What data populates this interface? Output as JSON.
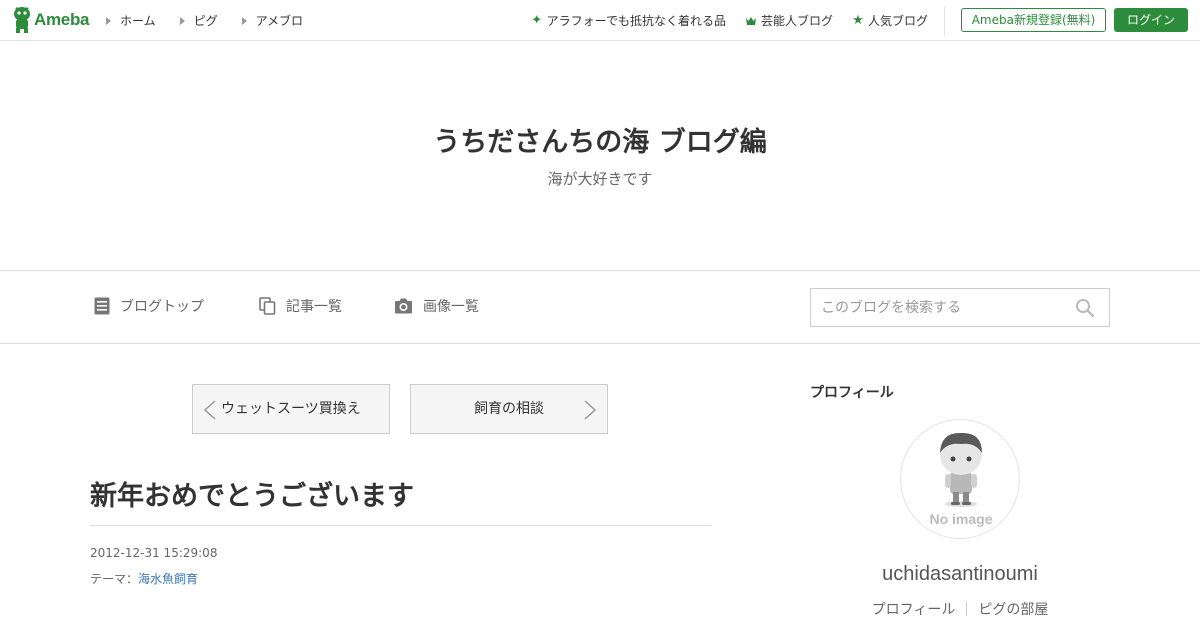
{
  "header": {
    "logo_text": "Ameba",
    "nav": [
      {
        "label": "ホーム"
      },
      {
        "label": "ピグ"
      },
      {
        "label": "アメブロ"
      }
    ],
    "links": [
      {
        "label": "アラフォーでも抵抗なく着れる品",
        "icon": "sparkle-icon"
      },
      {
        "label": "芸能人ブログ",
        "icon": "crown-icon"
      },
      {
        "label": "人気ブログ",
        "icon": "star-icon"
      }
    ],
    "register_label": "Ameba新規登録(無料)",
    "login_label": "ログイン",
    "accent_color": "#2d8c3c"
  },
  "blog": {
    "title": "うちださんちの海 ブログ編",
    "description": "海が大好きです"
  },
  "blog_nav": {
    "items": [
      {
        "label": "ブログトップ",
        "icon": "document-icon"
      },
      {
        "label": "記事一覧",
        "icon": "copy-icon"
      },
      {
        "label": "画像一覧",
        "icon": "camera-icon"
      }
    ],
    "search_placeholder": "このブログを検索する"
  },
  "pager": {
    "prev_label": "ウェットスーツ買換え",
    "next_label": "飼育の相談"
  },
  "entry": {
    "title": "新年おめでとうございます",
    "date": "2012-12-31 15:29:08",
    "theme_prefix": "テーマ：",
    "theme": "海水魚飼育",
    "link_color": "#3a78b4"
  },
  "sidebar": {
    "heading": "プロフィール",
    "avatar_text": "No image",
    "username": "uchidasantinoumi",
    "links": [
      {
        "label": "プロフィール"
      },
      {
        "label": "ピグの部屋"
      }
    ]
  }
}
